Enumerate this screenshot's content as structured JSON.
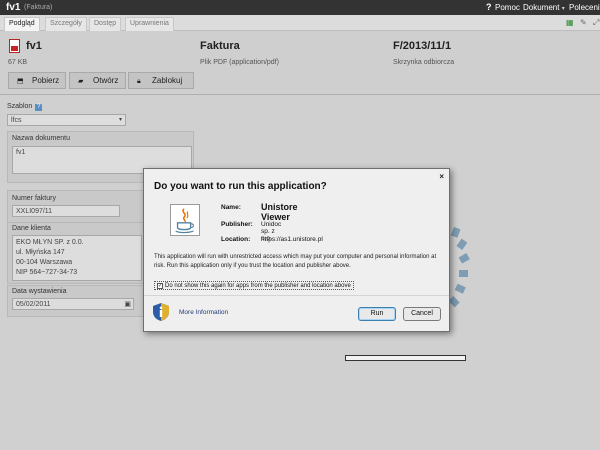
{
  "topbar": {
    "title": "fv1",
    "subtitle": "(Faktura)",
    "help_icon": "?",
    "help_label": "Pomoc",
    "document_menu": "Dokument",
    "commands_menu": "Polecenia"
  },
  "tabs": [
    {
      "label": "Podgląd",
      "active": true
    },
    {
      "label": "Szczegóły",
      "active": false
    },
    {
      "label": "Dostęp",
      "active": false
    },
    {
      "label": "Uprawnienia",
      "active": false
    }
  ],
  "header": {
    "name": "fv1",
    "size": "67 KB",
    "type": "Faktura",
    "mime": "Plik PDF (application/pdf)",
    "number": "F/2013/11/1",
    "mailbox": "Skrzynka odbiorcza",
    "buttons": {
      "download": "Pobierz",
      "open": "Otwórz",
      "lock": "Zablokuj"
    }
  },
  "form": {
    "template_label": "Szablon",
    "template_value": "lfcs",
    "docname_label": "Nazwa dokumentu",
    "docname_value": "fv1",
    "invoice_number_label": "Numer faktury",
    "invoice_number_value": "XXLI097/11",
    "client_label": "Dane klienta",
    "client_lines": [
      "EKO MŁYN SP. z 0.0.",
      "ul. Młyńska 147",
      "00-104 Warszawa",
      "NIP 564~727-34-73"
    ],
    "issue_date_label": "Data wystawienia",
    "issue_date_value": "05/02/2011"
  },
  "dialog": {
    "title": "Do you want to run this application?",
    "name_label": "Name:",
    "name_value": "Unistore Viewer",
    "publisher_label": "Publisher:",
    "publisher_value": "Unidoc sp. z o.o.",
    "location_label": "Location:",
    "location_value": "https://as1.unistore.pl",
    "warning": "This application will run with unrestricted access which may put your computer and personal information at risk. Run this application only if you trust the location and publisher above.",
    "checkbox_label": "Do not show this again for apps from the publisher and location above",
    "checkbox_checked": true,
    "more_info": "More Information",
    "run_button": "Run",
    "cancel_button": "Cancel",
    "close_icon": "×"
  },
  "colors": {
    "topbar": "#333333",
    "background": "#d0d0d0",
    "link_blue": "#243b7a",
    "pdf_red": "#cc2222",
    "java_orange": "#e76f00",
    "java_blue": "#5382a1",
    "spinner": "#7e9db4"
  },
  "icons": {
    "pdf": "pdf-file-icon",
    "download": "download-icon",
    "open": "open-folder-icon",
    "lock": "lock-icon",
    "calendar": "calendar-icon",
    "java": "java-icon",
    "shield": "info-shield-icon"
  }
}
